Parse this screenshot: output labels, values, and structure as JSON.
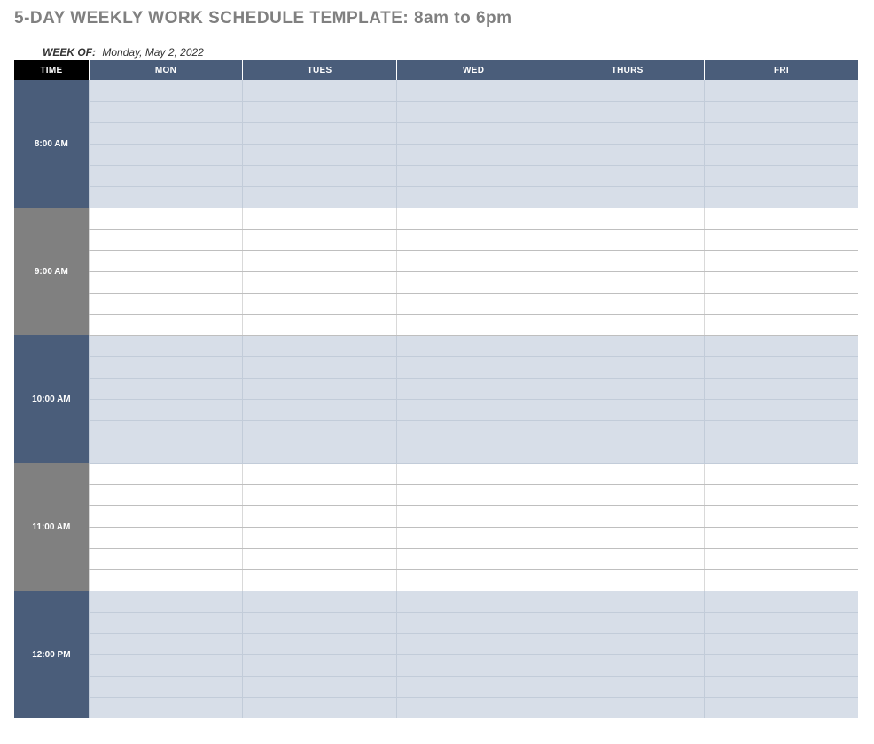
{
  "title": "5-DAY WEEKLY WORK SCHEDULE TEMPLATE: 8am to 6pm",
  "weekof_label": "WEEK OF:",
  "weekof_value": "Monday, May 2, 2022",
  "headers": {
    "time": "TIME",
    "days": [
      "MON",
      "TUES",
      "WED",
      "THURS",
      "FRI"
    ]
  },
  "time_blocks": [
    {
      "label": "8:00 AM",
      "shade": "blue",
      "rows": 6
    },
    {
      "label": "9:00 AM",
      "shade": "gray",
      "rows": 6
    },
    {
      "label": "10:00 AM",
      "shade": "blue",
      "rows": 6
    },
    {
      "label": "11:00 AM",
      "shade": "gray",
      "rows": 6
    },
    {
      "label": "12:00 PM",
      "shade": "blue",
      "rows": 6
    }
  ]
}
